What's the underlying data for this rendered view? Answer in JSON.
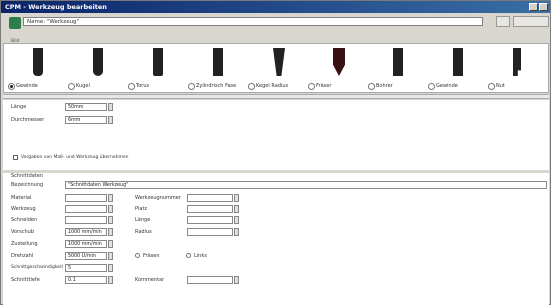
{
  "window": {
    "title": "CPM - Werkzeug bearbeiten"
  },
  "header": {
    "name_value": "Name: \"Werkzeug\"",
    "small_label": "Bild"
  },
  "tools": [
    {
      "label": "Gewinde",
      "selected": true
    },
    {
      "label": "Kugel",
      "selected": false
    },
    {
      "label": "Torus",
      "selected": false
    },
    {
      "label": "Zylindrisch Fase",
      "selected": false
    },
    {
      "label": "Kegel Radius",
      "selected": false
    },
    {
      "label": "Fräser",
      "selected": false
    },
    {
      "label": "Bohrer",
      "selected": false
    },
    {
      "label": "Gewinde",
      "selected": false
    },
    {
      "label": "Nut",
      "selected": false
    }
  ],
  "dims": {
    "laenge_label": "Länge",
    "laenge_value": "50mm",
    "durchmesser_label": "Durchmesser",
    "durchmesser_value": "6mm"
  },
  "checkbox_text": "Vorgaben von Maß- und Werkzeug übernehmen",
  "group": {
    "title": "Schnittdaten",
    "bezeichnung_label": "Bezeichnung",
    "bezeichnung_value": "\"Schnittdaten Werkzeug\"",
    "rows_left": [
      {
        "label": "Material",
        "value": ""
      },
      {
        "label": "Werkzeug",
        "value": ""
      },
      {
        "label": "Schneiden",
        "value": ""
      },
      {
        "label": "Vorschub",
        "value": "1000 mm/min"
      },
      {
        "label": "Zustellung",
        "value": "1000 mm/min"
      },
      {
        "label": "Drehzahl",
        "value": "5000 U/min"
      },
      {
        "label": "Schnittgeschwindigkeit",
        "value": "5"
      },
      {
        "label": "Schnitttiefe",
        "value": "0.1"
      }
    ],
    "rows_right": [
      {
        "label": "Werkzeugnummer",
        "value": ""
      },
      {
        "label": "Platz",
        "value": ""
      },
      {
        "label": "Länge",
        "value": ""
      },
      {
        "label": "Radius",
        "value": ""
      }
    ],
    "radio_a": "Fräsen",
    "radio_b": "Links",
    "bottom_right_label": "Kommentar"
  }
}
